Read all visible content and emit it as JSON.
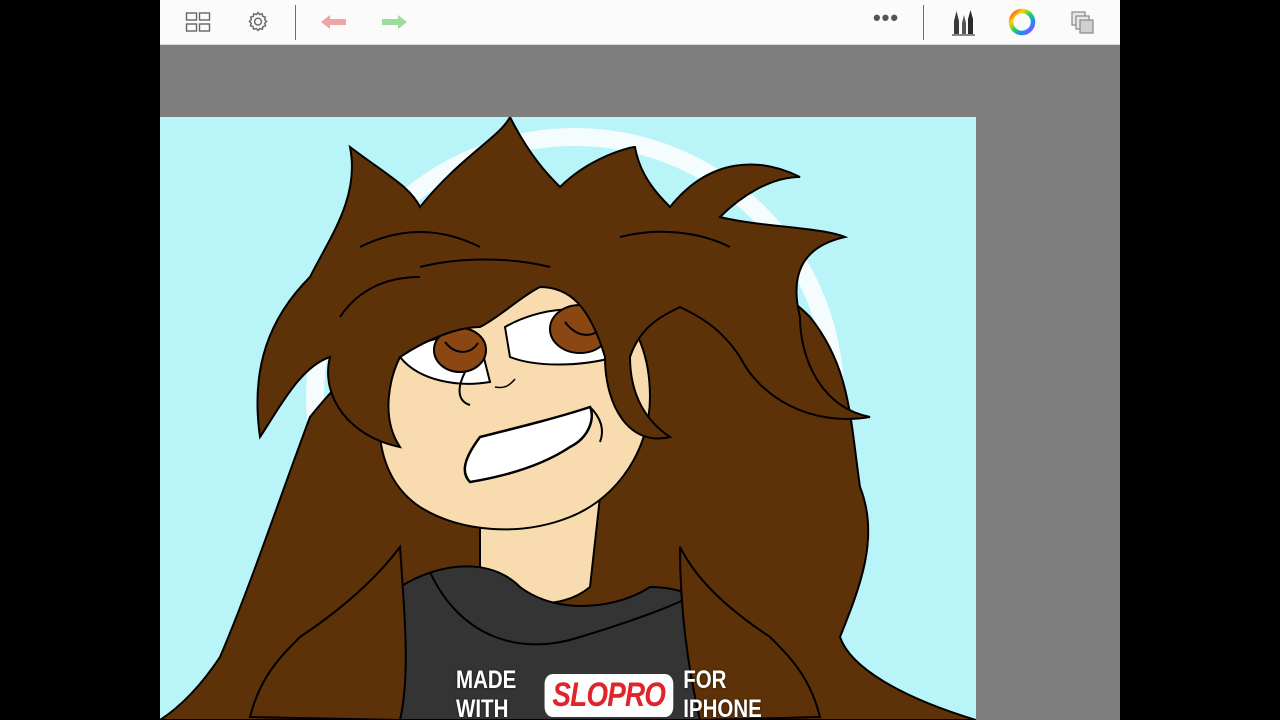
{
  "toolbar": {
    "icons": [
      "gallery-icon",
      "settings-icon",
      "undo-icon",
      "redo-icon",
      "more-icon",
      "brush-library-icon",
      "color-wheel-icon",
      "layers-icon"
    ],
    "more_label": "•••"
  },
  "colors": {
    "background": "#b8f4f8",
    "hair": "#5e3208",
    "skin": "#f8dbae",
    "shirt": "#343434",
    "iris": "#8a4713",
    "undo_color": "#f0a5a5",
    "redo_color": "#9fdb9f"
  },
  "watermark": {
    "prefix": "MADE WITH",
    "brand": "SLOPRO",
    "suffix": "FOR IPHONE"
  }
}
